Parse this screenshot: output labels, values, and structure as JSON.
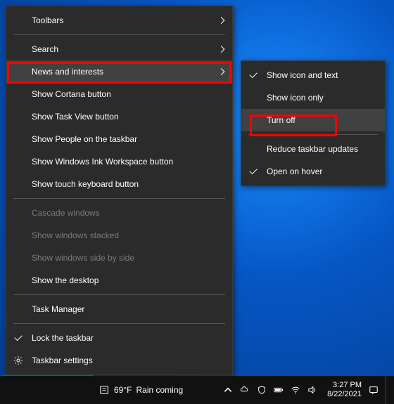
{
  "menu1": {
    "toolbars": "Toolbars",
    "search": "Search",
    "news": "News and interests",
    "cortana": "Show Cortana button",
    "taskview": "Show Task View button",
    "people": "Show People on the taskbar",
    "ink": "Show Windows Ink Workspace button",
    "touchkb": "Show touch keyboard button",
    "cascade": "Cascade windows",
    "stacked": "Show windows stacked",
    "sidebyside": "Show windows side by side",
    "showdesktop": "Show the desktop",
    "taskmgr": "Task Manager",
    "lock": "Lock the taskbar",
    "settings": "Taskbar settings"
  },
  "menu2": {
    "icontext": "Show icon and text",
    "icononly": "Show icon only",
    "turnoff": "Turn off",
    "reduce": "Reduce taskbar updates",
    "hover": "Open on hover"
  },
  "taskbar": {
    "weather_temp": "69°F",
    "weather_text": "Rain coming",
    "time": "3:27 PM",
    "date": "8/22/2021"
  }
}
